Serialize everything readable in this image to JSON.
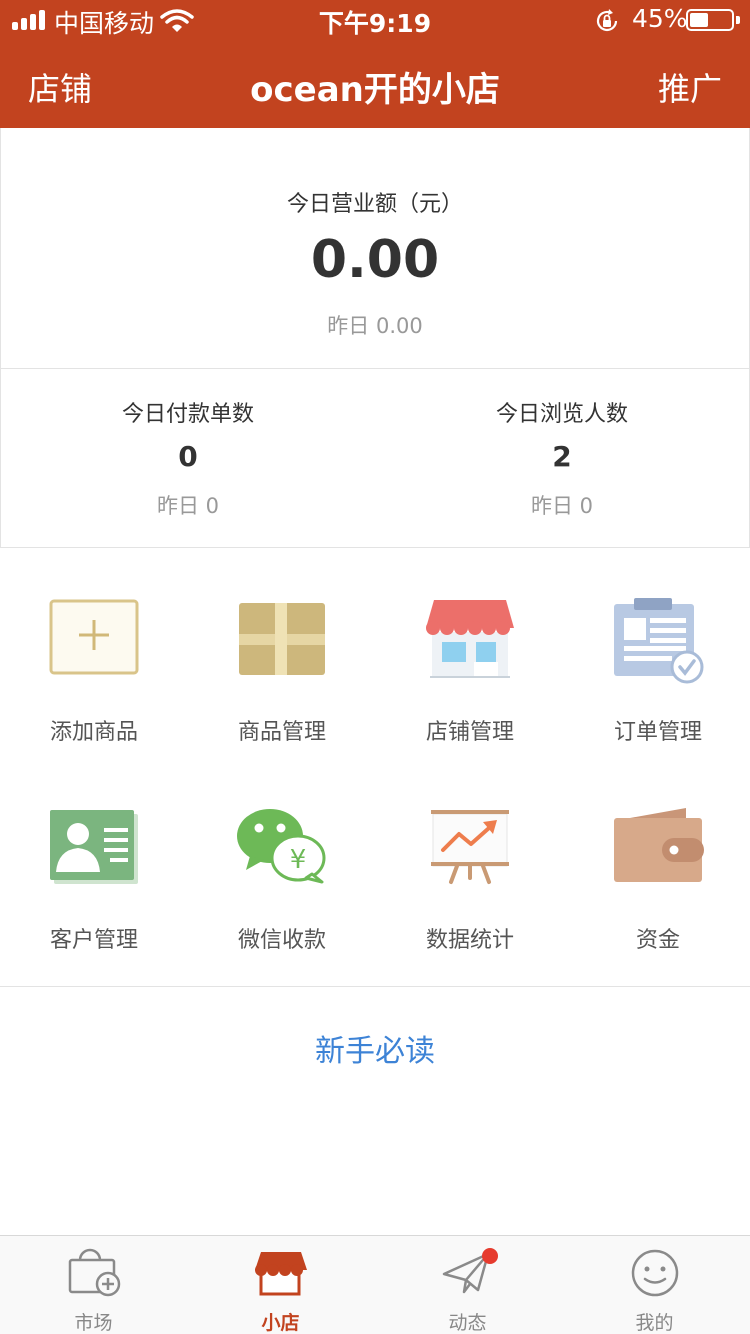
{
  "status_bar": {
    "carrier": "中国移动",
    "time": "下午9:19",
    "battery": "45%",
    "battery_level": 0.45
  },
  "header": {
    "left": "店铺",
    "title": "ocean开的小店",
    "right": "推广"
  },
  "revenue": {
    "label": "今日营业额（元）",
    "value": "0.00",
    "yesterday": "昨日 0.00"
  },
  "stats": [
    {
      "title": "今日付款单数",
      "value": "0",
      "yesterday": "昨日 0"
    },
    {
      "title": "今日浏览人数",
      "value": "2",
      "yesterday": "昨日 0"
    }
  ],
  "grid": [
    {
      "label": "添加商品",
      "icon": "add-product-icon"
    },
    {
      "label": "商品管理",
      "icon": "product-box-icon"
    },
    {
      "label": "店铺管理",
      "icon": "storefront-icon"
    },
    {
      "label": "订单管理",
      "icon": "order-clipboard-icon"
    },
    {
      "label": "客户管理",
      "icon": "customer-card-icon"
    },
    {
      "label": "微信收款",
      "icon": "wechat-payment-icon"
    },
    {
      "label": "数据统计",
      "icon": "data-chart-icon"
    },
    {
      "label": "资金",
      "icon": "wallet-icon"
    }
  ],
  "guide_link": "新手必读",
  "tabs": [
    {
      "label": "市场",
      "icon": "market-bag-icon",
      "active": false
    },
    {
      "label": "小店",
      "icon": "shop-icon",
      "active": true
    },
    {
      "label": "动态",
      "icon": "paper-plane-icon",
      "active": false,
      "badge": true
    },
    {
      "label": "我的",
      "icon": "smiley-face-icon",
      "active": false
    }
  ],
  "colors": {
    "brand": "#c2431f",
    "link": "#3d83d6",
    "badge": "#e63b2e"
  }
}
